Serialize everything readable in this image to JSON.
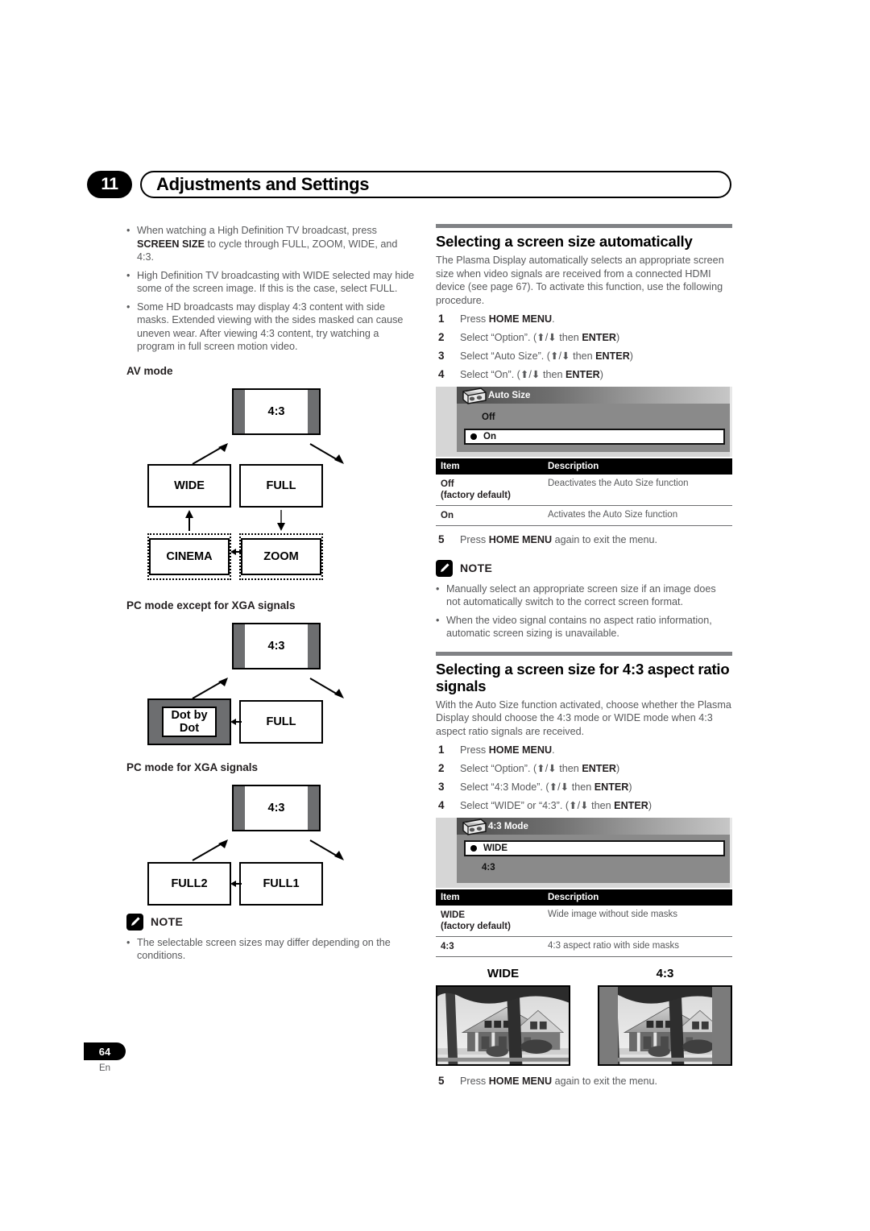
{
  "header": {
    "chapter_number": "11",
    "chapter_title": "Adjustments and Settings"
  },
  "left_column": {
    "intro_bullets": [
      {
        "lead": "When watching a High Definition TV broadcast, press ",
        "bold": "SCREEN SIZE",
        "tail": " to cycle through FULL, ZOOM, WIDE, and 4:3."
      },
      {
        "lead": "High Definition TV broadcasting with WIDE selected may hide some of the screen image. If this is the case, select FULL.",
        "bold": "",
        "tail": ""
      },
      {
        "lead": "Some HD broadcasts may display 4:3 content with side masks. Extended viewing with the sides masked can cause uneven wear. After viewing 4:3 content, try watching a program in full screen motion video.",
        "bold": "",
        "tail": ""
      }
    ],
    "av_mode_heading": "AV mode",
    "av_mode_boxes": {
      "top": "4:3",
      "left_mid": "WIDE",
      "right_mid": "FULL",
      "left_bottom": "CINEMA",
      "right_bottom": "ZOOM"
    },
    "pc_mode_heading": "PC mode except for XGA signals",
    "pc_mode_boxes": {
      "top": "4:3",
      "left": "Dot by Dot",
      "left_line1": "Dot by",
      "left_line2": "Dot",
      "right": "FULL"
    },
    "xga_heading": "PC mode for XGA signals",
    "xga_boxes": {
      "top": "4:3",
      "left": "FULL2",
      "right": "FULL1"
    },
    "note_label": "NOTE",
    "note_bullets": [
      "The selectable screen sizes may differ depending on the conditions."
    ]
  },
  "right_column": {
    "section1": {
      "title": "Selecting a screen size automatically",
      "body": "The Plasma Display automatically selects an appropriate screen size when video signals are received from a connected HDMI device (see page 67). To activate this function, use the following procedure.",
      "steps": [
        {
          "num": "1",
          "lead": "Press ",
          "bold": "HOME MENU",
          "tail": "."
        },
        {
          "num": "2",
          "lead": "Select “Option”. (⬆/⬇ then ",
          "bold": "ENTER",
          "tail": ")"
        },
        {
          "num": "3",
          "lead": "Select “Auto Size”. (⬆/⬇ then ",
          "bold": "ENTER",
          "tail": ")"
        },
        {
          "num": "4",
          "lead": "Select “On”. (⬆/⬇ then ",
          "bold": "ENTER",
          "tail": ")"
        }
      ],
      "osd": {
        "icon": "vcr-icon",
        "title": "Auto Size",
        "rows": [
          {
            "label": "Off",
            "selected": false
          },
          {
            "label": "On",
            "selected": true
          }
        ]
      },
      "table": {
        "headers": [
          "Item",
          "Description"
        ],
        "rows": [
          {
            "item": "Off",
            "item_sub": "(factory default)",
            "desc": "Deactivates the Auto Size function"
          },
          {
            "item": "On",
            "item_sub": "",
            "desc": "Activates the Auto Size function"
          }
        ]
      },
      "final_step": {
        "num": "5",
        "lead": "Press ",
        "bold": "HOME MENU",
        "tail": " again to exit the menu."
      },
      "note_label": "NOTE",
      "note_bullets": [
        "Manually select an appropriate screen size if an image does not automatically switch to the correct screen format.",
        "When the video signal contains no aspect ratio information, automatic screen sizing is unavailable."
      ]
    },
    "section2": {
      "title": "Selecting a screen size for 4:3 aspect ratio signals",
      "body": "With the Auto Size function activated, choose whether the Plasma Display should choose the 4:3 mode or WIDE mode when 4:3 aspect ratio signals are received.",
      "steps": [
        {
          "num": "1",
          "lead": "Press ",
          "bold": "HOME MENU",
          "tail": "."
        },
        {
          "num": "2",
          "lead": "Select “Option”. (⬆/⬇ then ",
          "bold": "ENTER",
          "tail": ")"
        },
        {
          "num": "3",
          "lead": "Select “4:3 Mode”. (⬆/⬇ then ",
          "bold": "ENTER",
          "tail": ")"
        },
        {
          "num": "4",
          "lead": "Select “WIDE” or “4:3”. (⬆/⬇ then ",
          "bold": "ENTER",
          "tail": ")"
        }
      ],
      "osd": {
        "icon": "vcr-icon",
        "title": "4:3 Mode",
        "rows": [
          {
            "label": "WIDE",
            "selected": true
          },
          {
            "label": "4:3",
            "selected": false
          }
        ]
      },
      "table": {
        "headers": [
          "Item",
          "Description"
        ],
        "rows": [
          {
            "item": "WIDE",
            "item_sub": "(factory default)",
            "desc": "Wide image without side masks"
          },
          {
            "item": "4:3",
            "item_sub": "",
            "desc": "4:3 aspect ratio with side masks"
          }
        ]
      },
      "samples": [
        {
          "caption": "WIDE",
          "masked": false
        },
        {
          "caption": "4:3",
          "masked": true
        }
      ],
      "final_step": {
        "num": "5",
        "lead": "Press ",
        "bold": "HOME MENU",
        "tail": " again to exit the menu."
      }
    }
  },
  "footer": {
    "page_number": "64",
    "language": "En"
  },
  "colors": {
    "text_body": "#58595b",
    "text_dark": "#231f20",
    "rule": "#808285",
    "mask_gray": "#6d6e70",
    "osd_body": "#8a8a8a"
  }
}
